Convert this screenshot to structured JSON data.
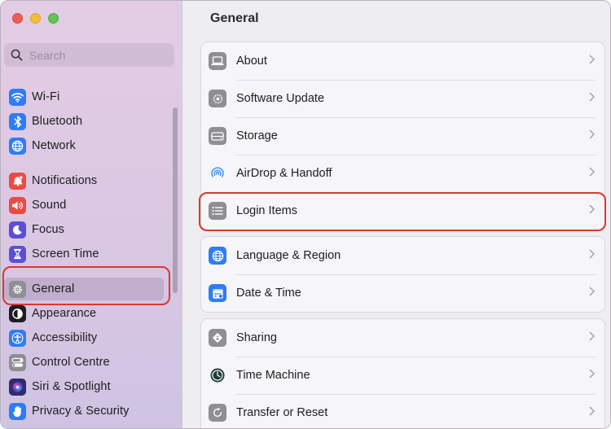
{
  "window": {
    "title": "General"
  },
  "search": {
    "placeholder": "Search"
  },
  "sidebar": {
    "items": [
      {
        "label": "Wi-Fi",
        "icon": "wifi-icon",
        "color": "#2f7cf6"
      },
      {
        "label": "Bluetooth",
        "icon": "bluetooth-icon",
        "color": "#2f7cf6"
      },
      {
        "label": "Network",
        "icon": "globe-icon",
        "color": "#2f7cf6"
      },
      {
        "label": "Notifications",
        "icon": "bell-icon",
        "color": "#ec4a42"
      },
      {
        "label": "Sound",
        "icon": "speaker-icon",
        "color": "#ec4a42"
      },
      {
        "label": "Focus",
        "icon": "moon-icon",
        "color": "#5b4fd6"
      },
      {
        "label": "Screen Time",
        "icon": "hourglass-icon",
        "color": "#5b4fd6"
      },
      {
        "label": "General",
        "icon": "gear-icon",
        "color": "#8e8e93",
        "selected": true
      },
      {
        "label": "Appearance",
        "icon": "appearance-icon",
        "color": "#1d1d1f"
      },
      {
        "label": "Accessibility",
        "icon": "accessibility-icon",
        "color": "#2f7cf6"
      },
      {
        "label": "Control Centre",
        "icon": "control-centre-icon",
        "color": "#8e8e93"
      },
      {
        "label": "Siri & Spotlight",
        "icon": "siri-icon",
        "color": "#2d2d6e"
      },
      {
        "label": "Privacy & Security",
        "icon": "hand-icon",
        "color": "#2f7cf6"
      }
    ]
  },
  "main": {
    "title": "General",
    "groups": [
      {
        "rows": [
          {
            "label": "About",
            "icon": "laptop-icon"
          },
          {
            "label": "Software Update",
            "icon": "software-update-icon"
          },
          {
            "label": "Storage",
            "icon": "storage-icon"
          },
          {
            "label": "AirDrop & Handoff",
            "icon": "airdrop-icon"
          },
          {
            "label": "Login Items",
            "icon": "list-icon"
          }
        ]
      },
      {
        "rows": [
          {
            "label": "Language & Region",
            "icon": "globe-icon"
          },
          {
            "label": "Date & Time",
            "icon": "calendar-icon"
          }
        ]
      },
      {
        "rows": [
          {
            "label": "Sharing",
            "icon": "sharing-icon"
          },
          {
            "label": "Time Machine",
            "icon": "time-machine-icon"
          },
          {
            "label": "Transfer or Reset",
            "icon": "reset-icon"
          }
        ]
      }
    ]
  },
  "annotations": {
    "color": "#d63a2f"
  }
}
